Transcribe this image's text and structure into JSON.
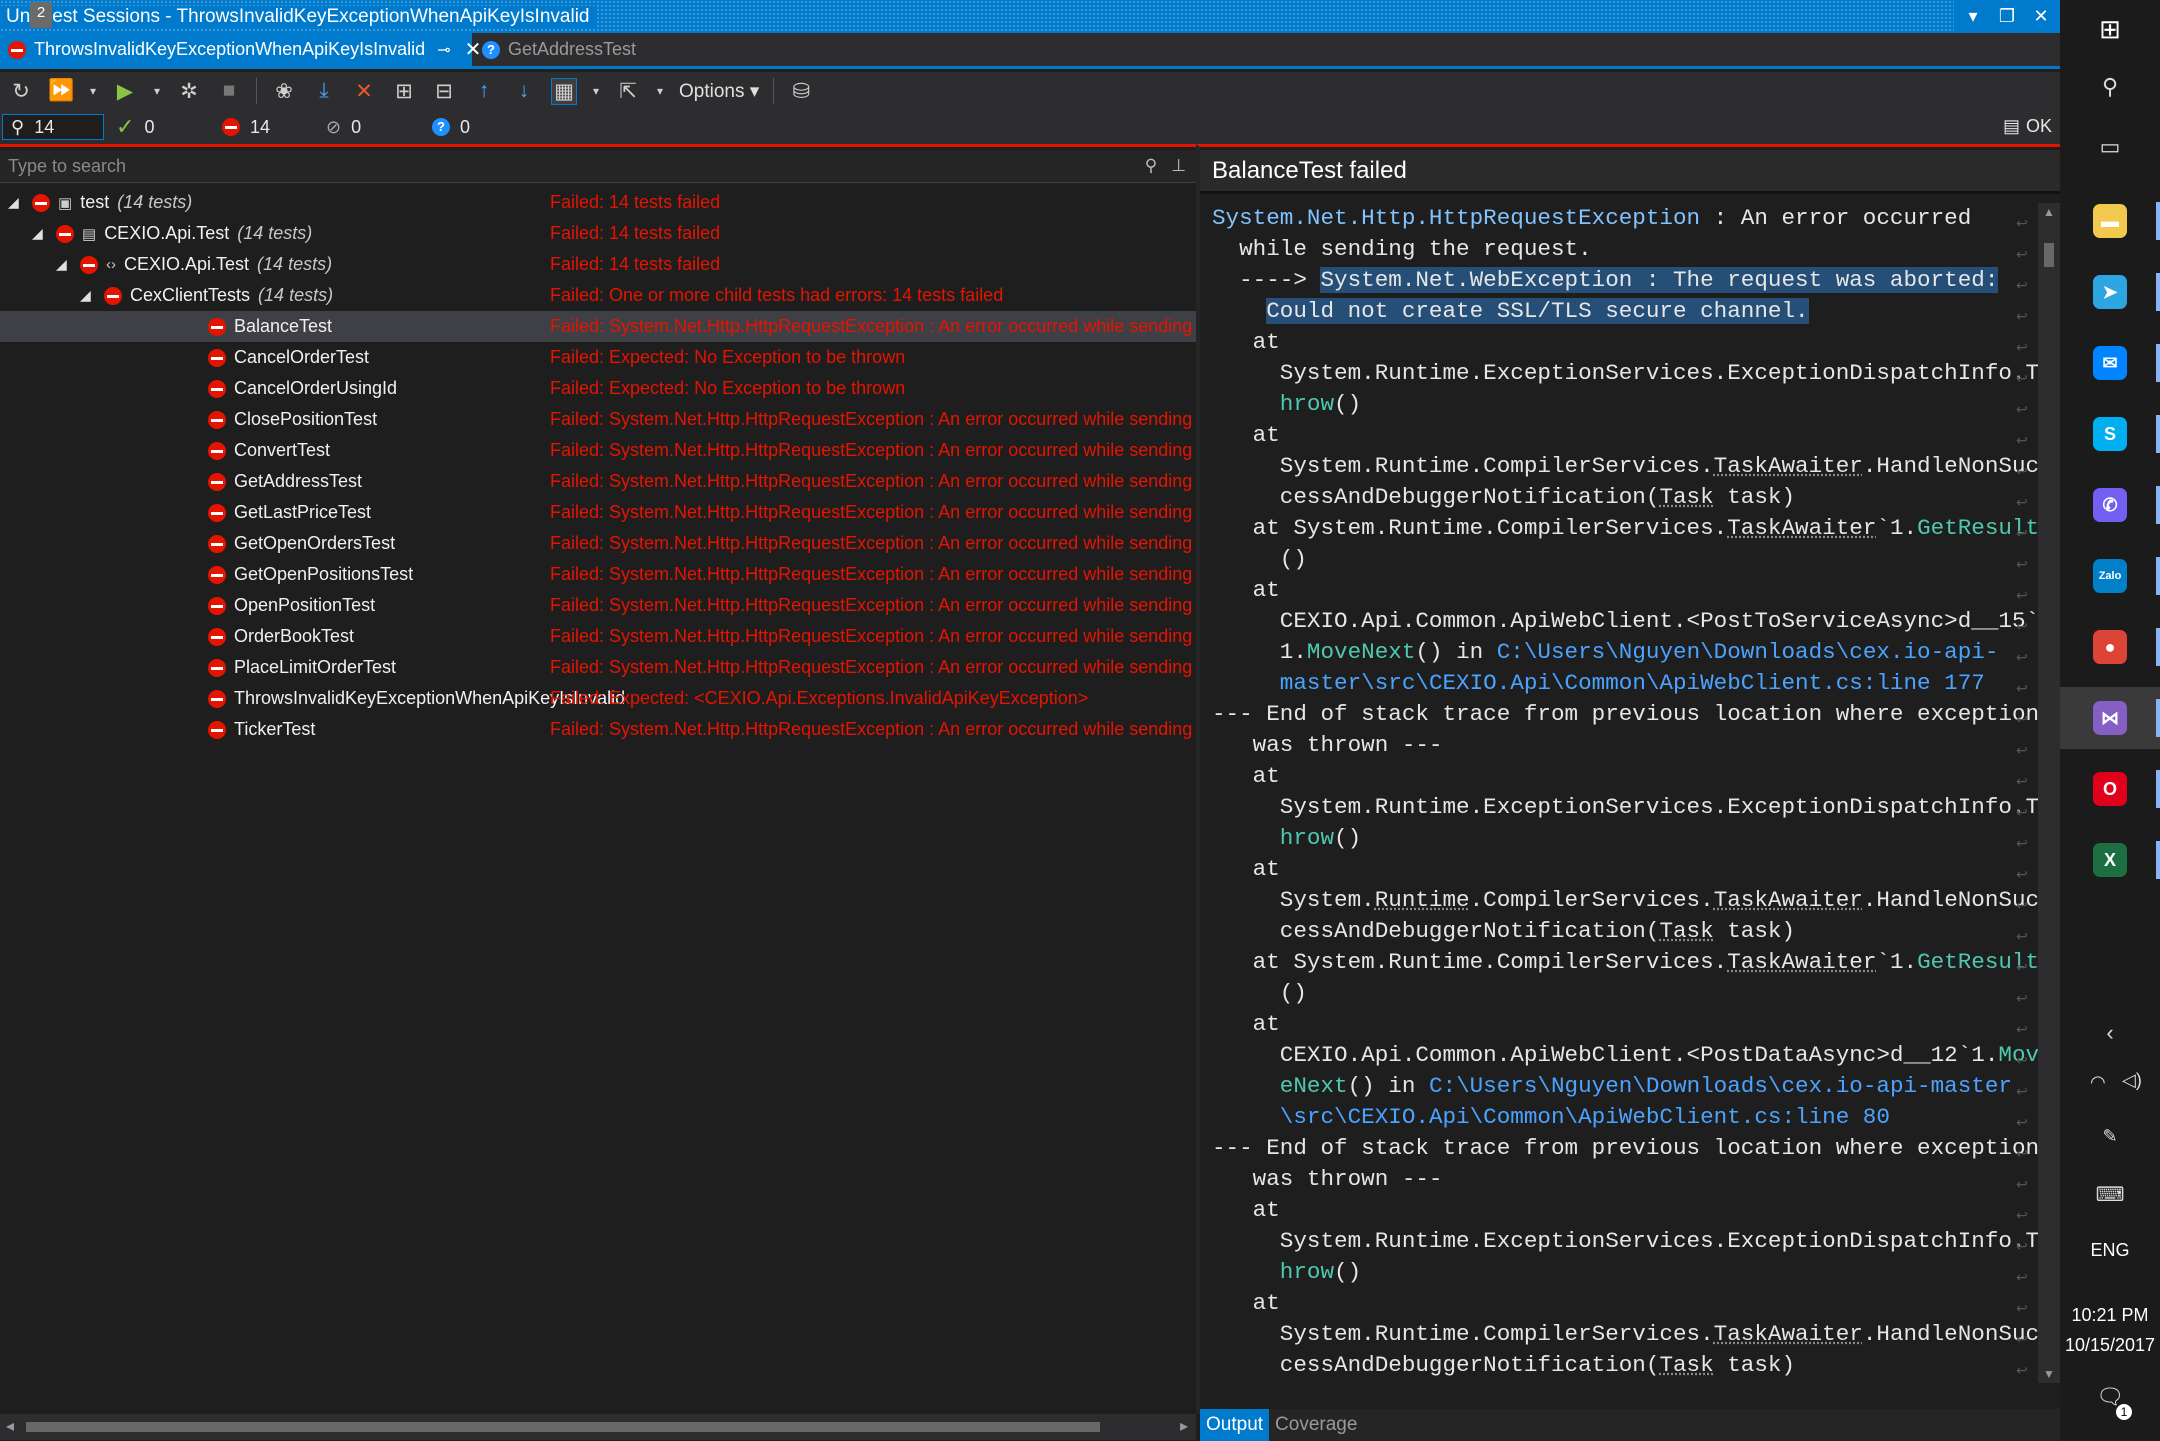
{
  "window": {
    "title_prefix": "Un",
    "title_badge": "2",
    "title_rest": "est Sessions - ThrowsInvalidKeyExceptionWhenApiKeyIsInvalid"
  },
  "tabs": [
    {
      "label": "ThrowsInvalidKeyExceptionWhenApiKeyIsInvalid",
      "active": true
    },
    {
      "label": "GetAddressTest",
      "active": false
    }
  ],
  "toolbar": {
    "options_label": "Options"
  },
  "counts": {
    "all": "14",
    "passed": "0",
    "failed": "14",
    "ignored": "0",
    "inconclusive": "0",
    "ok": "OK"
  },
  "search": {
    "placeholder": "Type to search"
  },
  "tree": [
    {
      "name": "test",
      "count": "(14 tests)",
      "status": "Failed: 14 tests failed",
      "level": 0
    },
    {
      "name": "CEXIO.Api.Test",
      "count": "(14 tests)",
      "status": "Failed: 14 tests failed",
      "level": 1
    },
    {
      "name": "CEXIO.Api.Test",
      "count": "(14 tests)",
      "status": "Failed: 14 tests failed",
      "level": 2
    },
    {
      "name": "CexClientTests",
      "count": "(14 tests)",
      "status": "Failed: One or more child tests had errors: 14 tests failed",
      "level": 3
    },
    {
      "name": "BalanceTest",
      "count": "",
      "status": "Failed: System.Net.Http.HttpRequestException : An error occurred while sending th",
      "level": 4
    },
    {
      "name": "CancelOrderTest",
      "count": "",
      "status": "Failed:   Expected: No Exception to be thrown",
      "level": 4
    },
    {
      "name": "CancelOrderUsingId",
      "count": "",
      "status": "Failed:   Expected: No Exception to be thrown",
      "level": 4
    },
    {
      "name": "ClosePositionTest",
      "count": "",
      "status": "Failed: System.Net.Http.HttpRequestException : An error occurred while sending th",
      "level": 4
    },
    {
      "name": "ConvertTest",
      "count": "",
      "status": "Failed: System.Net.Http.HttpRequestException : An error occurred while sending th",
      "level": 4
    },
    {
      "name": "GetAddressTest",
      "count": "",
      "status": "Failed: System.Net.Http.HttpRequestException : An error occurred while sending th",
      "level": 4
    },
    {
      "name": "GetLastPriceTest",
      "count": "",
      "status": "Failed: System.Net.Http.HttpRequestException : An error occurred while sending th",
      "level": 4
    },
    {
      "name": "GetOpenOrdersTest",
      "count": "",
      "status": "Failed: System.Net.Http.HttpRequestException : An error occurred while sending th",
      "level": 4
    },
    {
      "name": "GetOpenPositionsTest",
      "count": "",
      "status": "Failed: System.Net.Http.HttpRequestException : An error occurred while sending th",
      "level": 4
    },
    {
      "name": "OpenPositionTest",
      "count": "",
      "status": "Failed: System.Net.Http.HttpRequestException : An error occurred while sending th",
      "level": 4
    },
    {
      "name": "OrderBookTest",
      "count": "",
      "status": "Failed: System.Net.Http.HttpRequestException : An error occurred while sending th",
      "level": 4
    },
    {
      "name": "PlaceLimitOrderTest",
      "count": "",
      "status": "Failed: System.Net.Http.HttpRequestException : An error occurred while sending th",
      "level": 4
    },
    {
      "name": "ThrowsInvalidKeyExceptionWhenApiKeyIsInvalid",
      "count": "",
      "status": "Failed:   Expected: <CEXIO.Api.Exceptions.InvalidApiKeyException>",
      "level": 4
    },
    {
      "name": "TickerTest",
      "count": "",
      "status": "Failed: System.Net.Http.HttpRequestException : An error occurred while sending th",
      "level": 4
    }
  ],
  "details": {
    "header": "BalanceTest failed",
    "lines": [
      {
        "parts": [
          {
            "t": "System.Net.Http.HttpRequestException",
            "c": "type"
          },
          {
            "t": " : An error occurred"
          }
        ]
      },
      {
        "parts": [
          {
            "t": "  while sending the request."
          }
        ]
      },
      {
        "parts": [
          {
            "t": "  ----> "
          },
          {
            "t": "System.Net.WebException : The request was aborted:",
            "c": "hl"
          }
        ]
      },
      {
        "parts": [
          {
            "t": "    "
          },
          {
            "t": "Could not create SSL/TLS secure channel.",
            "c": "hl"
          }
        ]
      },
      {
        "parts": [
          {
            "t": "   at"
          }
        ]
      },
      {
        "parts": [
          {
            "t": "     System.Runtime.ExceptionServices.ExceptionDispatchInfo.T"
          }
        ]
      },
      {
        "parts": [
          {
            "t": "     "
          },
          {
            "t": "hrow",
            "c": "kw"
          },
          {
            "t": "()"
          }
        ]
      },
      {
        "parts": [
          {
            "t": "   at"
          }
        ]
      },
      {
        "parts": [
          {
            "t": "     System.Runtime.CompilerServices."
          },
          {
            "t": "TaskAwaiter",
            "c": "dot"
          },
          {
            "t": ".HandleNonSuc"
          }
        ]
      },
      {
        "parts": [
          {
            "t": "     cessAndDebuggerNotification("
          },
          {
            "t": "Task",
            "c": "dot"
          },
          {
            "t": " task)"
          }
        ]
      },
      {
        "parts": [
          {
            "t": "   at System.Runtime.CompilerServices."
          },
          {
            "t": "TaskAwaiter",
            "c": "dot"
          },
          {
            "t": "`1."
          },
          {
            "t": "GetResult",
            "c": "kw"
          }
        ]
      },
      {
        "parts": [
          {
            "t": "     ()"
          }
        ]
      },
      {
        "parts": [
          {
            "t": "   at"
          }
        ]
      },
      {
        "parts": [
          {
            "t": "     CEXIO.Api.Common.ApiWebClient.<PostToServiceAsync>d__15`"
          }
        ]
      },
      {
        "parts": [
          {
            "t": "     1."
          },
          {
            "t": "MoveNext",
            "c": "kw"
          },
          {
            "t": "() in "
          },
          {
            "t": "C:\\Users\\Nguyen\\Downloads\\cex.io-api-",
            "c": "path"
          }
        ]
      },
      {
        "parts": [
          {
            "t": "     "
          },
          {
            "t": "master\\src\\CEXIO.Api\\Common\\ApiWebClient.cs:line 177",
            "c": "path"
          }
        ]
      },
      {
        "parts": [
          {
            "t": "--- End of stack trace from previous location where exception"
          }
        ]
      },
      {
        "parts": [
          {
            "t": "   was thrown ---"
          }
        ]
      },
      {
        "parts": [
          {
            "t": "   at"
          }
        ]
      },
      {
        "parts": [
          {
            "t": "     System.Runtime.ExceptionServices.ExceptionDispatchInfo.T"
          }
        ]
      },
      {
        "parts": [
          {
            "t": "     "
          },
          {
            "t": "hrow",
            "c": "kw"
          },
          {
            "t": "()"
          }
        ]
      },
      {
        "parts": [
          {
            "t": "   at"
          }
        ]
      },
      {
        "parts": [
          {
            "t": "     System."
          },
          {
            "t": "Runtime",
            "c": "dot"
          },
          {
            "t": ".CompilerServices."
          },
          {
            "t": "TaskAwaiter",
            "c": "dot"
          },
          {
            "t": ".HandleNonSuc"
          }
        ]
      },
      {
        "parts": [
          {
            "t": "     cessAndDebuggerNotification("
          },
          {
            "t": "Task",
            "c": "dot"
          },
          {
            "t": " task)"
          }
        ]
      },
      {
        "parts": [
          {
            "t": "   at System.Runtime.CompilerServices."
          },
          {
            "t": "TaskAwaiter",
            "c": "dot"
          },
          {
            "t": "`1."
          },
          {
            "t": "GetResult",
            "c": "kw"
          }
        ]
      },
      {
        "parts": [
          {
            "t": "     ()"
          }
        ]
      },
      {
        "parts": [
          {
            "t": "   at"
          }
        ]
      },
      {
        "parts": [
          {
            "t": "     CEXIO.Api.Common.ApiWebClient.<PostDataAsync>d__12`1."
          },
          {
            "t": "Mov",
            "c": "kw"
          }
        ]
      },
      {
        "parts": [
          {
            "t": "     "
          },
          {
            "t": "eNext",
            "c": "kw"
          },
          {
            "t": "() in "
          },
          {
            "t": "C:\\Users\\Nguyen\\Downloads\\cex.io-api-master",
            "c": "path"
          }
        ]
      },
      {
        "parts": [
          {
            "t": "     "
          },
          {
            "t": "\\src\\CEXIO.Api\\Common\\ApiWebClient.cs:line 80",
            "c": "path"
          }
        ]
      },
      {
        "parts": [
          {
            "t": "--- End of stack trace from previous location where exception"
          }
        ]
      },
      {
        "parts": [
          {
            "t": "   was thrown ---"
          }
        ]
      },
      {
        "parts": [
          {
            "t": "   at"
          }
        ]
      },
      {
        "parts": [
          {
            "t": "     System.Runtime.ExceptionServices.ExceptionDispatchInfo.T"
          }
        ]
      },
      {
        "parts": [
          {
            "t": "     "
          },
          {
            "t": "hrow",
            "c": "kw"
          },
          {
            "t": "()"
          }
        ]
      },
      {
        "parts": [
          {
            "t": "   at"
          }
        ]
      },
      {
        "parts": [
          {
            "t": "     System.Runtime.CompilerServices."
          },
          {
            "t": "TaskAwaiter",
            "c": "dot"
          },
          {
            "t": ".HandleNonSuc"
          }
        ]
      },
      {
        "parts": [
          {
            "t": "     cessAndDebuggerNotification("
          },
          {
            "t": "Task",
            "c": "dot"
          },
          {
            "t": " task)"
          }
        ]
      }
    ]
  },
  "footer_tabs": {
    "output": "Output",
    "coverage": "Coverage"
  },
  "taskbar": {
    "apps": [
      {
        "name": "file-explorer-icon",
        "glyph": "▬",
        "color": "#f2c94c"
      },
      {
        "name": "telegram-icon",
        "glyph": "➤",
        "color": "#2ca5e0"
      },
      {
        "name": "messenger-icon",
        "glyph": "✉",
        "color": "#0084ff"
      },
      {
        "name": "skype-icon",
        "glyph": "S",
        "color": "#00aff0"
      },
      {
        "name": "viber-icon",
        "glyph": "✆",
        "color": "#7360f2"
      },
      {
        "name": "zalo-icon",
        "glyph": "Zalo",
        "color": "#0180c7"
      },
      {
        "name": "chrome-icon",
        "glyph": "●",
        "color": "#db4437"
      },
      {
        "name": "visual-studio-icon",
        "glyph": "⋈",
        "color": "#865fc5"
      },
      {
        "name": "opera-icon",
        "glyph": "O",
        "color": "#e0001b"
      },
      {
        "name": "excel-icon",
        "glyph": "X",
        "color": "#1d6f42"
      }
    ],
    "lang": "ENG",
    "time": "10:21 PM",
    "date": "10/15/2017",
    "notif_count": "1"
  }
}
